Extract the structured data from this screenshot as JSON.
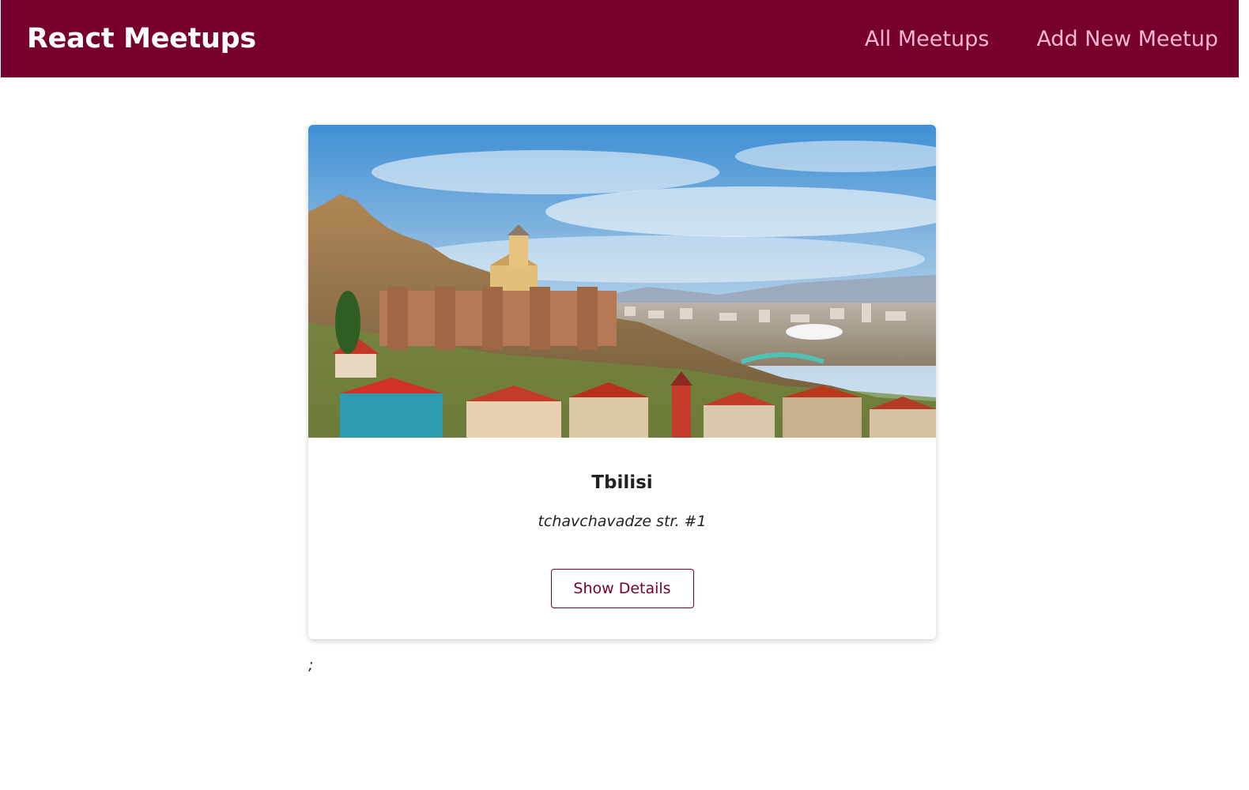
{
  "header": {
    "logo": "React Meetups",
    "nav": [
      {
        "label": "All Meetups"
      },
      {
        "label": "Add New Meetup"
      }
    ]
  },
  "meetups": [
    {
      "title": "Tbilisi",
      "address": "tchavchavadze str. #1",
      "button_label": "Show Details"
    }
  ],
  "trailing_text": ";",
  "colors": {
    "header_bg": "#77002e",
    "nav_link": "#fcb8d2",
    "accent": "#77002e"
  }
}
